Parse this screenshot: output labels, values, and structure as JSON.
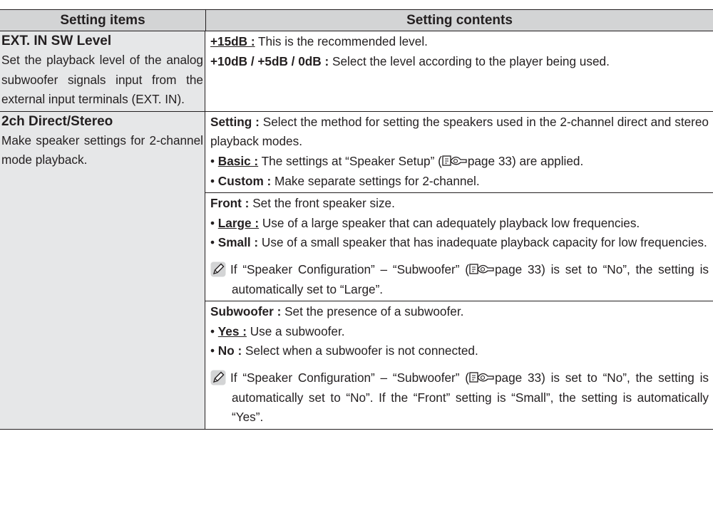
{
  "header": {
    "col1": "Setting items",
    "col2": "Setting contents"
  },
  "rows": [
    {
      "title": "EXT. IN SW Level",
      "desc": "Set the playback level of the analog subwoofer signals in­put from the external input terminals (EXT. IN).",
      "lines": [
        {
          "k": "+15dB :",
          "t": " This is the recommended level."
        },
        {
          "k": "+10dB / +5dB / 0dB :",
          "t": " Select the level according to the player being used."
        }
      ]
    },
    {
      "title": "2ch Direct/Stereo",
      "desc": "Make speaker settings for 2-channel mode playback.",
      "setting": {
        "k": "Setting :",
        "t": " Select the method for setting the speakers used in the 2-channel direct and stereo playback modes."
      },
      "basic": {
        "k": "Basic :",
        "t1": " The settings at “Speaker Setup” (",
        "t2": "page 33) are applied."
      },
      "custom": {
        "k": "Custom :",
        "t": " Make separate settings for 2-channel."
      },
      "front": {
        "k": "Front :",
        "t": " Set the front speaker size."
      },
      "large": {
        "k": "Large :",
        "t": " Use of a large speaker that can adequately playback low frequencies."
      },
      "small": {
        "k": "Small :",
        "t": " Use of a small speaker that has inadequate playback capacity for low frequencies."
      },
      "note1": {
        "t1": "If “Speaker Configuration” – “Subwoofer” (",
        "t2": "page 33) is set to “No”, the setting is automatically set to “Large”."
      },
      "subwoofer": {
        "k": "Subwoofer :",
        "t": " Set the presence of a subwoofer."
      },
      "yes": {
        "k": "Yes :",
        "t": " Use a subwoofer."
      },
      "no": {
        "k": "No :",
        "t": " Select when a subwoofer is not connected."
      },
      "note2": {
        "t1": "If “Speaker Configuration” – “Subwoofer” (",
        "t2": "page 33) is set to “No”, the setting is automatically set to “No”. If the “Front” setting is “Small”, the setting is automatically “Yes”."
      }
    }
  ],
  "icons": {
    "note": "pencil-icon",
    "reference": "page-reference-icon"
  },
  "colors": {
    "header_bg": "#d3d4d5",
    "left_bg": "#e6e7e8",
    "text": "#231f20"
  }
}
